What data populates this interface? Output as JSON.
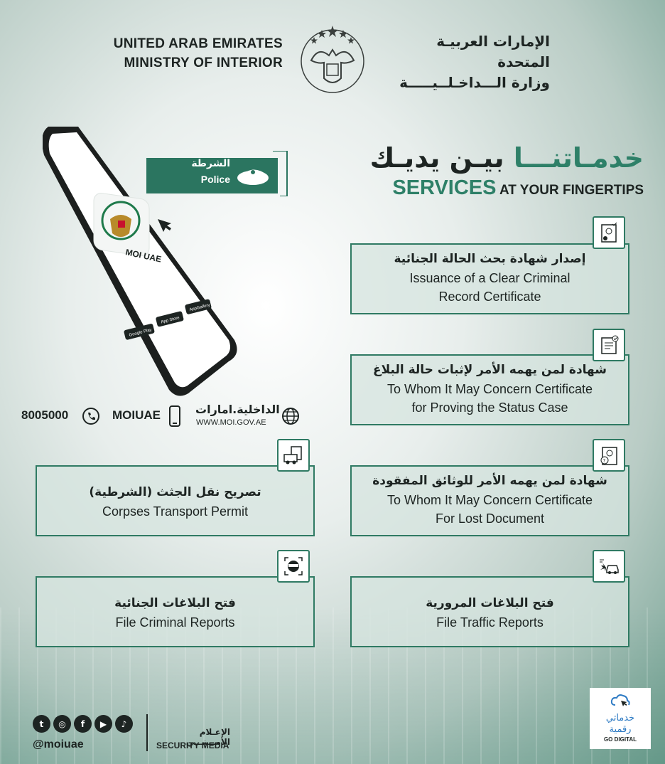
{
  "header": {
    "en_line1": "UNITED ARAB EMIRATES",
    "en_line2": "MINISTRY OF INTERIOR",
    "ar_line1": "الإمارات العربيـة المتحدة",
    "ar_line2": "وزارة الـــداخـلــيـــــة"
  },
  "phone": {
    "app_name": "MOI UAE",
    "store_badges": [
      "Google Play",
      "App Store",
      "AppGallery"
    ]
  },
  "police_tag": {
    "ar": "الشرطة",
    "en": "Police"
  },
  "contacts": {
    "phone": "8005000",
    "social": "MOIUAE",
    "web_ar": "الداخلية.امارات",
    "web_en": "WWW.MOI.GOV.AE"
  },
  "services_heading": {
    "ar_part1": "خدمـاتنـــا",
    "ar_part2": "بيـن يديـك",
    "en_big": "SERVICES",
    "en_small": "AT YOUR FINGERTIPS"
  },
  "cards": {
    "criminal_record": {
      "ar": "إصدار شهادة بحث الحالة الجنائية",
      "en1": "Issuance of a Clear Criminal",
      "en2": "Record Certificate"
    },
    "status_case": {
      "ar": "شهادة لمن يهمه الأمر لإثبات حالة البلاغ",
      "en1": "To Whom It May Concern Certificate",
      "en2": "for Proving the Status Case"
    },
    "lost_document": {
      "ar": "شهادة لمن يهمه الأمر للوثائق المفقودة",
      "en1": "To Whom It May Concern Certificate",
      "en2": "For Lost Document"
    },
    "corpses_permit": {
      "ar": "تصريح نقل الجثث (الشرطية)",
      "en1": "Corpses Transport Permit"
    },
    "criminal_reports": {
      "ar": "فتح البلاغات الجنائية",
      "en1": "File Criminal Reports"
    },
    "traffic_reports": {
      "ar": "فتح البلاغات المرورية",
      "en1": "File Traffic Reports"
    }
  },
  "footer": {
    "handle": "@moiuae",
    "security_media_ar": "الإعـلام الأمـــنـــي",
    "security_media_en": "SECURITY MEDIA",
    "go_digital_ar1": "خدماتي",
    "go_digital_ar2": "رقمية",
    "go_digital_en": "GO DIGITAL"
  },
  "colors": {
    "accent": "#2e8068",
    "border": "#2f7a63",
    "dark": "#1d2422"
  }
}
